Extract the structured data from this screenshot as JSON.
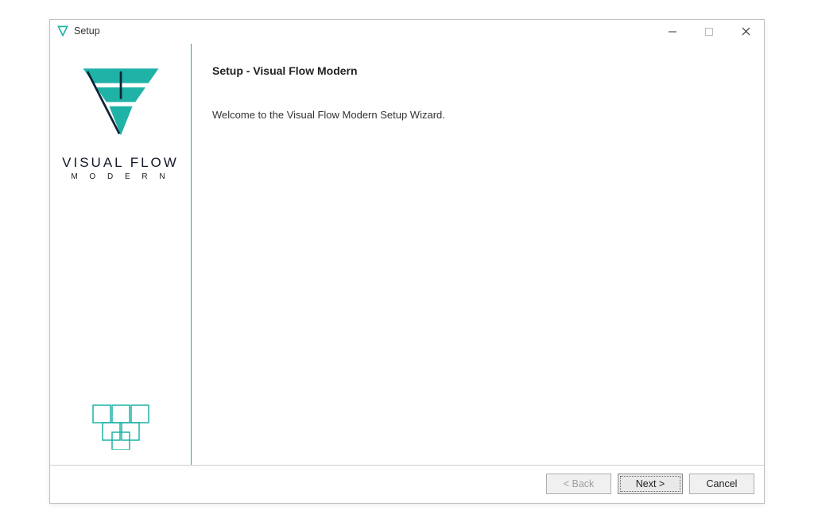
{
  "window": {
    "title": "Setup"
  },
  "sidebar": {
    "brand_line1": "VISUAL FLOW",
    "brand_line2": "M O D E R N"
  },
  "content": {
    "heading": "Setup - Visual Flow Modern",
    "welcome": "Welcome to the Visual Flow Modern Setup Wizard."
  },
  "footer": {
    "back_label": "< Back",
    "next_label": "Next >",
    "cancel_label": "Cancel"
  },
  "colors": {
    "accent_teal": "#1fb2a6"
  }
}
